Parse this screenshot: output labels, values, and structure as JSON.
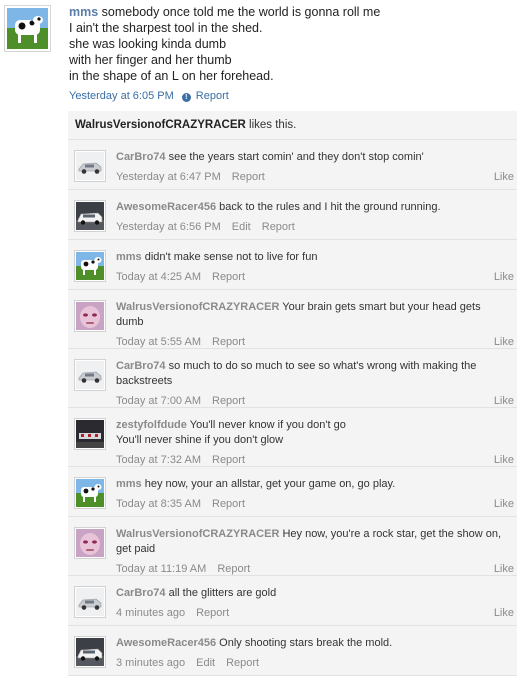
{
  "post": {
    "author": "mms",
    "lines": [
      "somebody once told me the world is gonna roll me",
      "I ain't the sharpest tool in the shed.",
      "she was looking kinda dumb",
      "with her finger and her thumb",
      "in the shape of an L on her forehead."
    ],
    "timestamp": "Yesterday at 6:05 PM",
    "report_label": "Report",
    "avatar": "cow-avatar"
  },
  "likes": {
    "user": "WalrusVersionofCRAZYRACER",
    "text": "likes this."
  },
  "comments": [
    {
      "author": "CarBro74",
      "avatar": "silver-car",
      "text": [
        "see the years start comin' and they don't stop comin'"
      ],
      "time": "Yesterday at 6:47 PM",
      "actions": [
        "Report"
      ],
      "like": "Like"
    },
    {
      "author": "AwesomeRacer456",
      "avatar": "white-car",
      "text": [
        "back to the rules and I hit the ground running."
      ],
      "time": "Yesterday at 6:56 PM",
      "actions": [
        "Edit",
        "Report"
      ],
      "like": ""
    },
    {
      "author": "mms",
      "avatar": "cow",
      "text": [
        "didn't make sense not to live for fun"
      ],
      "time": "Today at 4:25 AM",
      "actions": [
        "Report"
      ],
      "like": "Like"
    },
    {
      "author": "WalrusVersionofCRAZYRACER",
      "avatar": "pink-face",
      "text": [
        "Your brain gets smart but your head gets",
        "dumb"
      ],
      "time": "Today at 5:55 AM",
      "actions": [
        "Report"
      ],
      "like": "Like"
    },
    {
      "author": "CarBro74",
      "avatar": "silver-car",
      "text": [
        "so much to do so much to see so what's wrong with making the",
        "backstreets"
      ],
      "time": "Today at 7:00 AM",
      "actions": [
        "Report"
      ],
      "like": "Like"
    },
    {
      "author": "zestyfolfdude",
      "avatar": "dark-figure",
      "text": [
        "You'll never know if you don't go",
        "You'll never shine if you don't glow"
      ],
      "time": "Today at 7:32 AM",
      "actions": [
        "Report"
      ],
      "like": "Like"
    },
    {
      "author": "mms",
      "avatar": "cow",
      "text": [
        "hey now, your an allstar, get your game on, go play."
      ],
      "time": "Today at 8:35 AM",
      "actions": [
        "Report"
      ],
      "like": "Like"
    },
    {
      "author": "WalrusVersionofCRAZYRACER",
      "avatar": "pink-face",
      "text": [
        "Hey now, you're a rock star, get the show on,",
        "get paid"
      ],
      "time": "Today at 11:19 AM",
      "actions": [
        "Report"
      ],
      "like": "Like"
    },
    {
      "author": "CarBro74",
      "avatar": "silver-car",
      "text": [
        "all the glitters are gold"
      ],
      "time": "4 minutes ago",
      "actions": [
        "Report"
      ],
      "like": "Like"
    },
    {
      "author": "AwesomeRacer456",
      "avatar": "white-car",
      "text": [
        "Only shooting stars break the mold."
      ],
      "time": "3 minutes ago",
      "actions": [
        "Edit",
        "Report"
      ],
      "like": ""
    }
  ]
}
